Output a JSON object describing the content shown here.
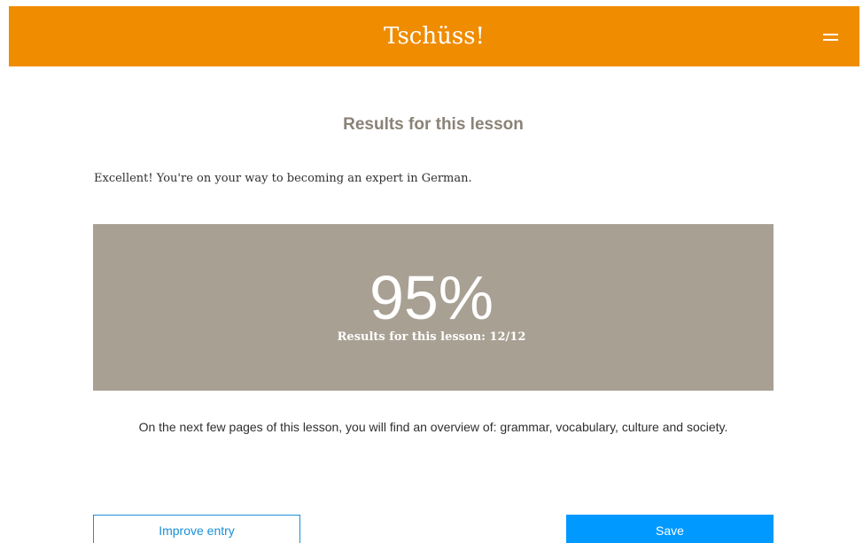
{
  "header": {
    "title": "Tschüss!",
    "menu_icon": "hamburger-menu-icon",
    "background_color": "#f08c00"
  },
  "results": {
    "heading": "Results for this lesson",
    "feedback": "Excellent! You're on your way to becoming an expert in German.",
    "score_percent": "95%",
    "score_summary": "Results for this lesson: 12/12",
    "panel_color": "#a8a093"
  },
  "overview": {
    "text": "On the next few pages of this lesson, you will find an overview of: grammar, vocabulary, culture and society."
  },
  "actions": {
    "improve_label": "Improve entry",
    "save_label": "Save",
    "accent_color": "#0099ff"
  }
}
